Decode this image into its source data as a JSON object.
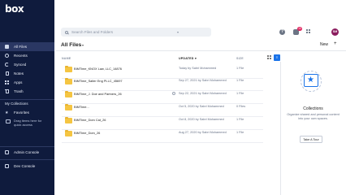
{
  "brand": {
    "logo_text": "box"
  },
  "sidebar": {
    "items": [
      {
        "label": "All Files",
        "icon": "folder-icon",
        "active": true
      },
      {
        "label": "Recents",
        "icon": "clock-icon",
        "active": false
      },
      {
        "label": "Synced",
        "icon": "sync-icon",
        "active": false
      },
      {
        "label": "Notes",
        "icon": "notes-icon",
        "active": false
      },
      {
        "label": "Apps",
        "icon": "apps-icon",
        "active": false
      },
      {
        "label": "Trash",
        "icon": "trash-icon",
        "active": false
      }
    ],
    "collections_label": "My Collections",
    "favorites_label": "Favorites",
    "drag_hint": "Drag items here for quick access",
    "admin_console": "Admin Console",
    "dev_console": "Dev Console"
  },
  "topbar": {
    "search_placeholder": "Search Files and Folders",
    "help_label": "?",
    "notification_count": "10",
    "avatar_initials": "SM"
  },
  "content": {
    "title": "All Files",
    "new_label": "New",
    "new_plus": "+",
    "columns": {
      "name": "NAME",
      "updated": "UPDATED",
      "size": "SIZE"
    },
    "rows": [
      {
        "name": "BIMTime_KNOX Law, LLC_14876",
        "updated": "Today by Sabri Mohammed",
        "size": "1 File"
      },
      {
        "name": "BIMTime_Salter Eng PLLC_45697",
        "updated": "Sep 27, 2021 by Sabri Mohammed",
        "size": "1 File"
      },
      {
        "name": "BIMTime_J. Doe and Partners_26",
        "updated": "Sep 22, 2021 by Sabri Mohammed",
        "size": "1 File"
      },
      {
        "name": "BIMTime...",
        "updated": "Oct 5, 2020 by Sabri Mohammed",
        "size": "0 Files"
      },
      {
        "name": "BIMTime_Dom Cat_26",
        "updated": "Oct 8, 2020 by Sabri Mohammed",
        "size": "1 File"
      },
      {
        "name": "BIMTime_Dom_26",
        "updated": "Aug 27, 2020 by Sabri Mohammed",
        "size": "1 File"
      }
    ]
  },
  "collections_panel": {
    "title": "Collections",
    "description": "Organize shared and personal content into your own spaces.",
    "tour_label": "Take A Tour"
  },
  "colors": {
    "sidebar_bg": "#0f1b3d",
    "accent": "#1a73e8",
    "folder": "#f5c542",
    "avatar": "#8b1c5e",
    "badge": "#e0245e"
  }
}
